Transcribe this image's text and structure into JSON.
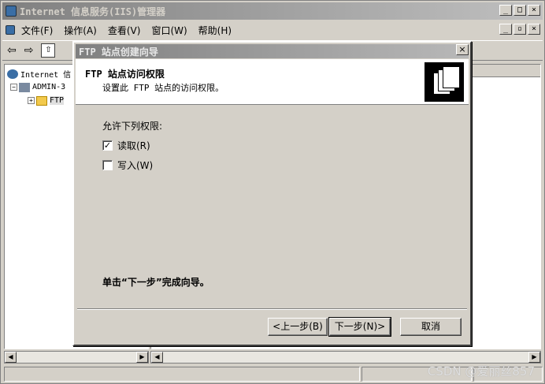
{
  "main_window": {
    "title": "Internet 信息服务(IIS)管理器",
    "menu": [
      "文件(F)",
      "操作(A)",
      "查看(V)",
      "窗口(W)",
      "帮助(H)"
    ],
    "tree": [
      {
        "label": "Internet 信",
        "icon": "globe-icon"
      },
      {
        "label": "ADMIN-3",
        "icon": "server-icon"
      },
      {
        "label": "FTP",
        "icon": "folder-icon"
      }
    ]
  },
  "dialog": {
    "title": "FTP 站点创建向导",
    "header_title": "FTP 站点访问权限",
    "header_subtitle": "设置此 FTP 站点的访问权限。",
    "permissions_label": "允许下列权限:",
    "permissions": [
      {
        "label": "读取(R)",
        "checked": true
      },
      {
        "label": "写入(W)",
        "checked": false
      }
    ],
    "finish_text": "单击“下一步”完成向导。",
    "buttons": {
      "back": "<上一步(B)",
      "next": "下一步(N)>",
      "cancel": "取消"
    }
  },
  "watermark": "CSDN @爱丽丝857"
}
